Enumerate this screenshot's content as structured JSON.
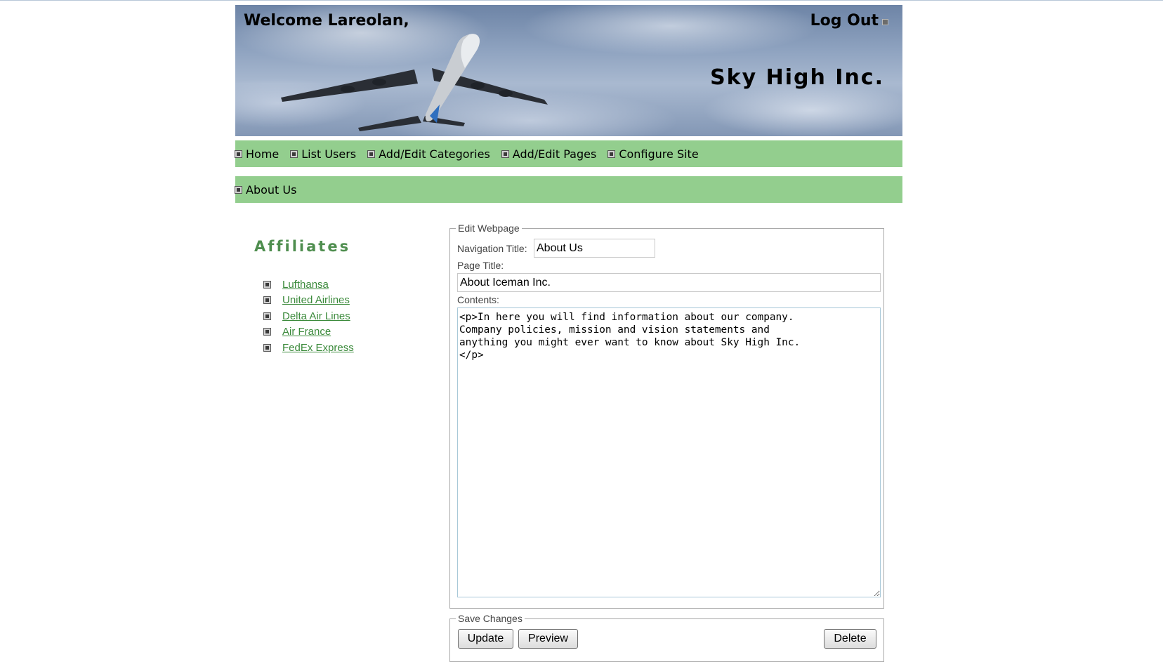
{
  "header": {
    "welcome": "Welcome Lareolan,",
    "logout_label": "Log Out",
    "site_title": "Sky High Inc."
  },
  "nav": {
    "main": [
      {
        "label": "Home"
      },
      {
        "label": "List Users"
      },
      {
        "label": "Add/Edit Categories"
      },
      {
        "label": "Add/Edit Pages"
      },
      {
        "label": "Configure Site"
      }
    ],
    "pages": [
      {
        "label": "About Us"
      }
    ]
  },
  "sidebar": {
    "title": "Affiliates",
    "links": [
      {
        "label": "Lufthansa"
      },
      {
        "label": "United Airlines"
      },
      {
        "label": "Delta Air Lines"
      },
      {
        "label": "Air France"
      },
      {
        "label": "FedEx Express"
      }
    ]
  },
  "edit_form": {
    "legend": "Edit Webpage",
    "nav_title_label": "Navigation Title:",
    "nav_title_value": "About Us",
    "page_title_label": "Page Title:",
    "page_title_value": "About Iceman Inc.",
    "contents_label": "Contents:",
    "contents_value": "<p>In here you will find information about our company.\nCompany policies, mission and vision statements and\nanything you might ever want to know about Sky High Inc.\n</p>"
  },
  "save_form": {
    "legend": "Save Changes",
    "update_label": "Update",
    "preview_label": "Preview",
    "delete_label": "Delete"
  },
  "colors": {
    "nav_background": "#93ce8e",
    "affiliates_title": "#4f8e4f",
    "link": "#3b8a3b"
  },
  "icons": {
    "bullet": "square-bullet-icon",
    "plane": "airplane-image"
  }
}
